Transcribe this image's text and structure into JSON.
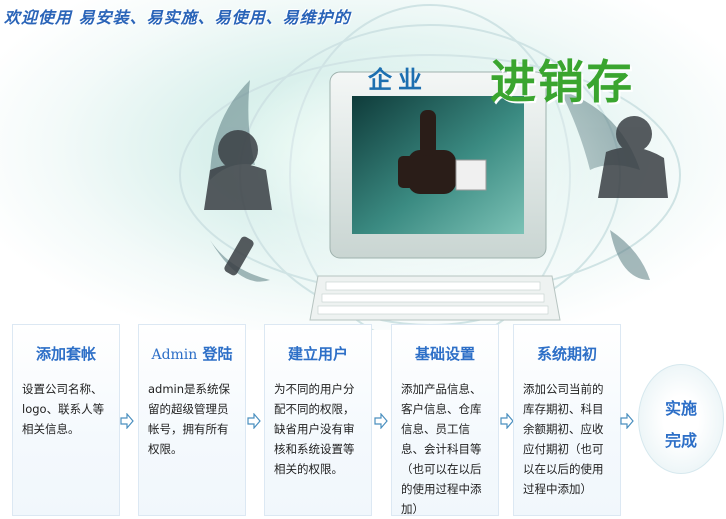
{
  "hero": {
    "tagline": "欢迎使用 易安装、易实施、易使用、易维护的",
    "brand_sub": "企业",
    "brand_main": "进销存"
  },
  "steps": [
    {
      "title": "添加套帐",
      "desc": "设置公司名称、logo、联系人等相关信息。"
    },
    {
      "title_en": "Admin",
      "title": "登陆",
      "desc": "admin是系统保留的超级管理员帐号，拥有所有权限。"
    },
    {
      "title": "建立用户",
      "desc": "为不同的用户分配不同的权限，缺省用户没有审核和系统设置等相关的权限。"
    },
    {
      "title": "基础设置",
      "desc": "添加产品信息、客户信息、仓库信息、员工信息、会计科目等（也可以在以后的使用过程中添加）"
    },
    {
      "title": "系统期初",
      "desc": "添加公司当前的库存期初、科目余额期初、应收应付期初（也可以在以后的使用过程中添加）"
    }
  ],
  "finish": {
    "line1": "实施",
    "line2": "完成"
  },
  "colors": {
    "accent": "#2d6fc7",
    "brand": "#3aa52f"
  }
}
